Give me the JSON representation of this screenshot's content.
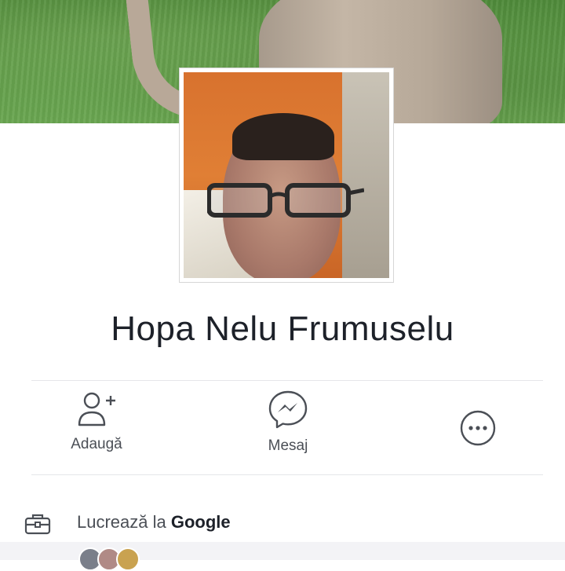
{
  "profile": {
    "name": "Hopa Nelu Frumuselu"
  },
  "actions": [
    {
      "label": "Adaugă",
      "icon": "add-friend-icon"
    },
    {
      "label": "Mesaj",
      "icon": "messenger-icon"
    },
    {
      "label": "",
      "icon": "more-options-icon"
    }
  ],
  "work": {
    "prefix": "Lucrează la ",
    "company": "Google",
    "icon": "briefcase-icon"
  },
  "colors": {
    "text_dark": "#1d2129",
    "text_gray": "#4b4f56",
    "divider": "#e5e6e9"
  }
}
